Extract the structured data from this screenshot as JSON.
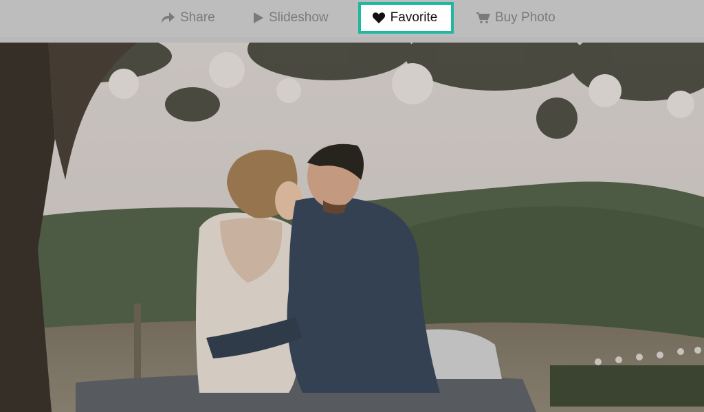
{
  "toolbar": {
    "items": [
      {
        "label": "Share",
        "icon": "share-arrow-icon"
      },
      {
        "label": "Slideshow",
        "icon": "play-icon"
      },
      {
        "label": "Favorite",
        "icon": "heart-icon",
        "selected": true
      },
      {
        "label": "Buy Photo",
        "icon": "cart-icon"
      }
    ]
  },
  "photo": {
    "subject": "couple-photo"
  },
  "colors": {
    "toolbar_bg": "#bdbdbd",
    "toolbar_text": "#7a7a7a",
    "active_border": "#1db89e",
    "active_bg": "#ffffff"
  }
}
